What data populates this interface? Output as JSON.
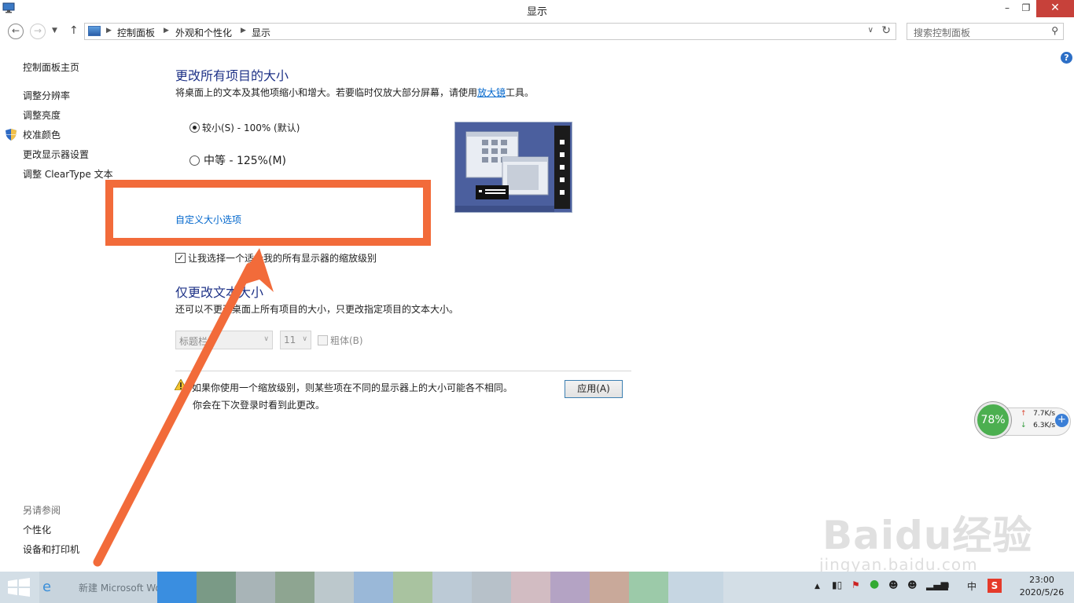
{
  "window": {
    "title": "显示",
    "minimize": "–",
    "maximize": "❐",
    "close": "✕"
  },
  "nav": {
    "breadcrumbs": [
      "控制面板",
      "外观和个性化",
      "显示"
    ],
    "search_placeholder": "搜索控制面板"
  },
  "sidebar": {
    "home": "控制面板主页",
    "items": [
      "调整分辨率",
      "调整亮度",
      "校准颜色",
      "更改显示器设置",
      "调整 ClearType 文本"
    ],
    "see_also_title": "另请参阅",
    "see_also": [
      "个性化",
      "设备和打印机"
    ]
  },
  "main": {
    "title": "更改所有项目的大小",
    "description_pre": "将桌面上的文本及其他项缩小和增大。若要临时仅放大部分屏幕，请使用",
    "description_link": "放大镜",
    "description_post": "工具。",
    "options": [
      {
        "label": "较小(S) - 100% (默认)",
        "checked": true
      },
      {
        "label": "中等 - 125%(M)",
        "checked": false
      }
    ],
    "custom_link": "自定义大小选项",
    "scale_checkbox_label": "让我选择一个适合我的所有显示器的缩放级别",
    "scale_checkbox_checked": true,
    "text_section_title": "仅更改文本大小",
    "text_section_desc": "还可以不更改桌面上所有项目的大小，只更改指定项目的文本大小。",
    "item_select": "标题栏",
    "size_select": "11",
    "bold_label": "粗体(B)",
    "warning_line1": "如果你使用一个缩放级别，则某些项在不同的显示器上的大小可能各不相同。",
    "warning_line2": "你会在下次登录时看到此更改。",
    "apply_label": "应用(A)"
  },
  "network_widget": {
    "percent": "78%",
    "up": "7.7K/s",
    "down": "6.3K/s",
    "plus": "+"
  },
  "watermark": {
    "brand": "Baidu经验",
    "url": "jingyan.baidu.com"
  },
  "taskbar": {
    "app_label": "新建 Microsoft Word",
    "ime": "中",
    "time": "23:00",
    "date": "2020/5/26"
  },
  "colors": {
    "annotation": "#f26b3a",
    "link": "#0066cc",
    "heading": "#1e3287",
    "taskbar": "#d3dee6"
  }
}
